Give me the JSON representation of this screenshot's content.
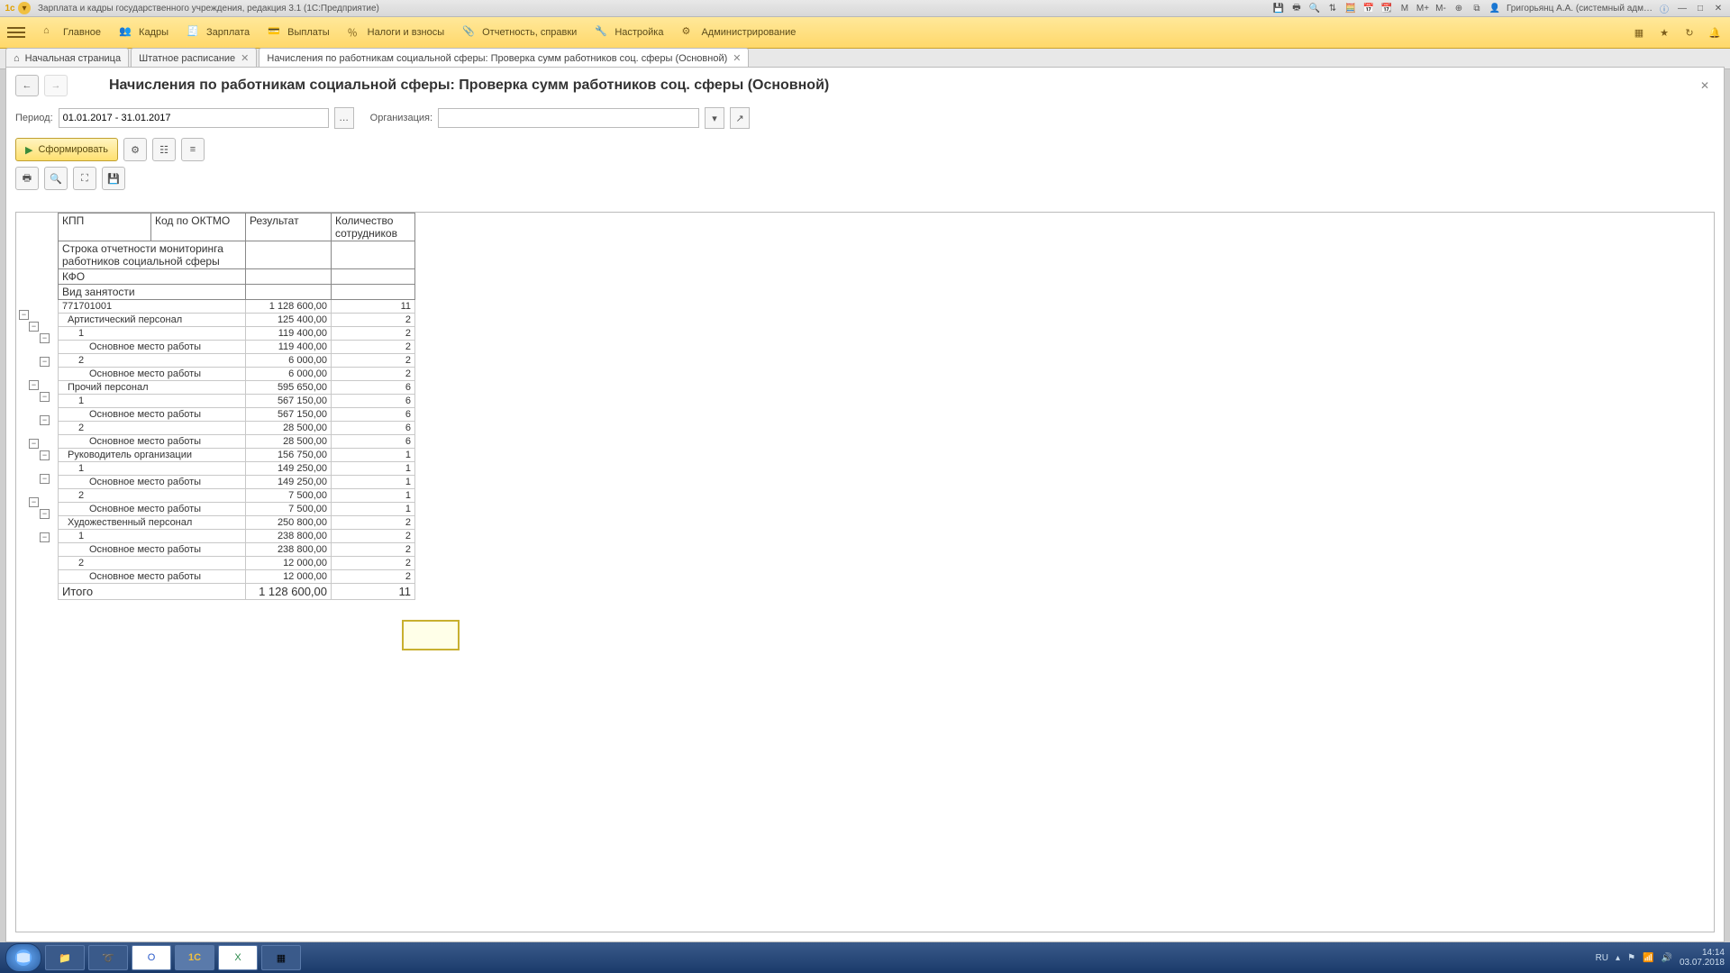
{
  "titlebar": {
    "title": "Зарплата и кадры государственного учреждения, редакция 3.1  (1С:Предприятие)",
    "user": "Григорьянц А.А. (системный адм…",
    "m": "M",
    "mplus": "M+",
    "mminus": "M-"
  },
  "menu": {
    "items": [
      {
        "label": "Главное",
        "icon": "home"
      },
      {
        "label": "Кадры",
        "icon": "people"
      },
      {
        "label": "Зарплата",
        "icon": "calc"
      },
      {
        "label": "Выплаты",
        "icon": "wallet"
      },
      {
        "label": "Налоги и взносы",
        "icon": "percent"
      },
      {
        "label": "Отчетность, справки",
        "icon": "clip"
      },
      {
        "label": "Настройка",
        "icon": "wrench"
      },
      {
        "label": "Администрирование",
        "icon": "gear"
      }
    ]
  },
  "tabs": [
    {
      "label": "Начальная страница",
      "icon": "home",
      "closable": false,
      "active": false
    },
    {
      "label": "Штатное расписание",
      "closable": true,
      "active": false
    },
    {
      "label": "Начисления по работникам социальной сферы: Проверка сумм работников соц. сферы (Основной)",
      "closable": true,
      "active": true
    }
  ],
  "page": {
    "title": "Начисления по работникам социальной сферы: Проверка сумм работников соц. сферы (Основной)",
    "period_label": "Период:",
    "period_value": "01.01.2017 - 31.01.2017",
    "org_label": "Организация:",
    "org_value": "",
    "form_button": "Сформировать"
  },
  "report": {
    "columns": {
      "kpp": "КПП",
      "oktmo": "Код по ОКТМО",
      "result": "Результат",
      "count": "Количество сотрудников"
    },
    "subheaders": [
      "Строка отчетности мониторинга работников социальной сферы",
      "КФО",
      "Вид занятости"
    ],
    "rows": [
      {
        "lvl": 0,
        "label": "771701001",
        "res": "1 128 600,00",
        "cnt": "11"
      },
      {
        "lvl": 1,
        "label": "Артистический персонал",
        "res": "125 400,00",
        "cnt": "2"
      },
      {
        "lvl": 2,
        "label": "1",
        "res": "119 400,00",
        "cnt": "2"
      },
      {
        "lvl": 3,
        "label": "Основное место работы",
        "res": "119 400,00",
        "cnt": "2"
      },
      {
        "lvl": 2,
        "label": "2",
        "res": "6 000,00",
        "cnt": "2"
      },
      {
        "lvl": 3,
        "label": "Основное место работы",
        "res": "6 000,00",
        "cnt": "2"
      },
      {
        "lvl": 1,
        "label": "Прочий персонал",
        "res": "595 650,00",
        "cnt": "6"
      },
      {
        "lvl": 2,
        "label": "1",
        "res": "567 150,00",
        "cnt": "6"
      },
      {
        "lvl": 3,
        "label": "Основное место работы",
        "res": "567 150,00",
        "cnt": "6"
      },
      {
        "lvl": 2,
        "label": "2",
        "res": "28 500,00",
        "cnt": "6"
      },
      {
        "lvl": 3,
        "label": "Основное место работы",
        "res": "28 500,00",
        "cnt": "6"
      },
      {
        "lvl": 1,
        "label": "Руководитель организации",
        "res": "156 750,00",
        "cnt": "1"
      },
      {
        "lvl": 2,
        "label": "1",
        "res": "149 250,00",
        "cnt": "1"
      },
      {
        "lvl": 3,
        "label": "Основное место работы",
        "res": "149 250,00",
        "cnt": "1"
      },
      {
        "lvl": 2,
        "label": "2",
        "res": "7 500,00",
        "cnt": "1"
      },
      {
        "lvl": 3,
        "label": "Основное место работы",
        "res": "7 500,00",
        "cnt": "1"
      },
      {
        "lvl": 1,
        "label": "Художественный персонал",
        "res": "250 800,00",
        "cnt": "2"
      },
      {
        "lvl": 2,
        "label": "1",
        "res": "238 800,00",
        "cnt": "2"
      },
      {
        "lvl": 3,
        "label": "Основное место работы",
        "res": "238 800,00",
        "cnt": "2"
      },
      {
        "lvl": 2,
        "label": "2",
        "res": "12 000,00",
        "cnt": "2"
      },
      {
        "lvl": 3,
        "label": "Основное место работы",
        "res": "12 000,00",
        "cnt": "2"
      }
    ],
    "total": {
      "label": "Итого",
      "res": "1 128 600,00",
      "cnt": "11"
    }
  },
  "tray": {
    "lang": "RU",
    "time": "14:14",
    "date": "03.07.2018"
  }
}
